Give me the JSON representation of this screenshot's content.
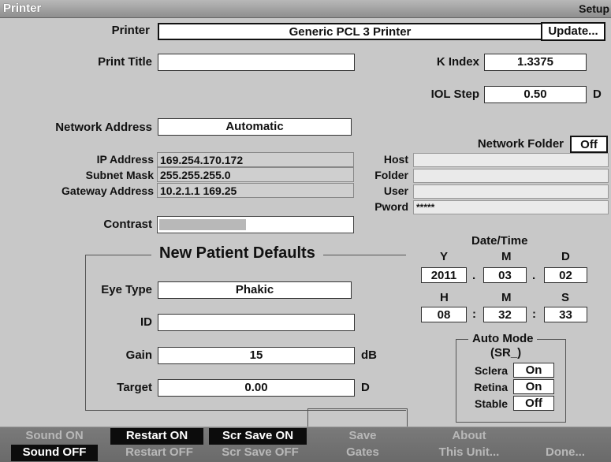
{
  "window": {
    "title": "Printer",
    "section": "Setup"
  },
  "printer": {
    "label": "Printer",
    "value": "Generic PCL 3 Printer",
    "update_button": "Update..."
  },
  "print_title": {
    "label": "Print Title",
    "value": ""
  },
  "k_index": {
    "label": "K Index",
    "value": "1.3375"
  },
  "iol_step": {
    "label": "IOL Step",
    "value": "0.50",
    "unit": "D"
  },
  "network_address": {
    "label": "Network Address",
    "value": "Automatic"
  },
  "network_folder": {
    "label": "Network Folder",
    "value": "Off"
  },
  "ip": {
    "label": "IP Address",
    "value": "169.254.170.172"
  },
  "subnet": {
    "label": "Subnet Mask",
    "value": "255.255.255.0"
  },
  "gateway": {
    "label": "Gateway Address",
    "value": "10.2.1.1 169.25"
  },
  "host": {
    "label": "Host",
    "value": ""
  },
  "folder": {
    "label": "Folder",
    "value": ""
  },
  "user": {
    "label": "User",
    "value": ""
  },
  "pword": {
    "label": "Pword",
    "value": "*****"
  },
  "contrast": {
    "label": "Contrast",
    "level": 0.45
  },
  "defaults": {
    "title": "New Patient Defaults",
    "eye_type": {
      "label": "Eye Type",
      "value": "Phakic"
    },
    "id": {
      "label": "ID",
      "value": ""
    },
    "gain": {
      "label": "Gain",
      "value": "15",
      "unit": "dB"
    },
    "target": {
      "label": "Target",
      "value": "0.00",
      "unit": "D"
    }
  },
  "datetime": {
    "title": "Date/Time",
    "y_label": "Y",
    "m_label": "M",
    "d_label": "D",
    "year": "2011",
    "month": "03",
    "day": "02",
    "date_sep1": ".",
    "date_sep2": ".",
    "h_label": "H",
    "min_label": "M",
    "s_label": "S",
    "hour": "08",
    "minute": "32",
    "second": "33",
    "time_sep1": ":",
    "time_sep2": ":"
  },
  "auto_mode": {
    "title": "Auto Mode",
    "subtitle": "(SR_)",
    "sclera": {
      "label": "Sclera",
      "value": "On"
    },
    "retina": {
      "label": "Retina",
      "value": "On"
    },
    "stable": {
      "label": "Stable",
      "value": "Off"
    }
  },
  "bottom": {
    "sound_on": "Sound ON",
    "sound_off": "Sound OFF",
    "restart_on": "Restart ON",
    "restart_off": "Restart OFF",
    "scr_on": "Scr Save ON",
    "scr_off": "Scr Save OFF",
    "save_gates_1": "Save",
    "save_gates_2": "Gates",
    "about_1": "About",
    "about_2": "This Unit...",
    "done": "Done..."
  }
}
